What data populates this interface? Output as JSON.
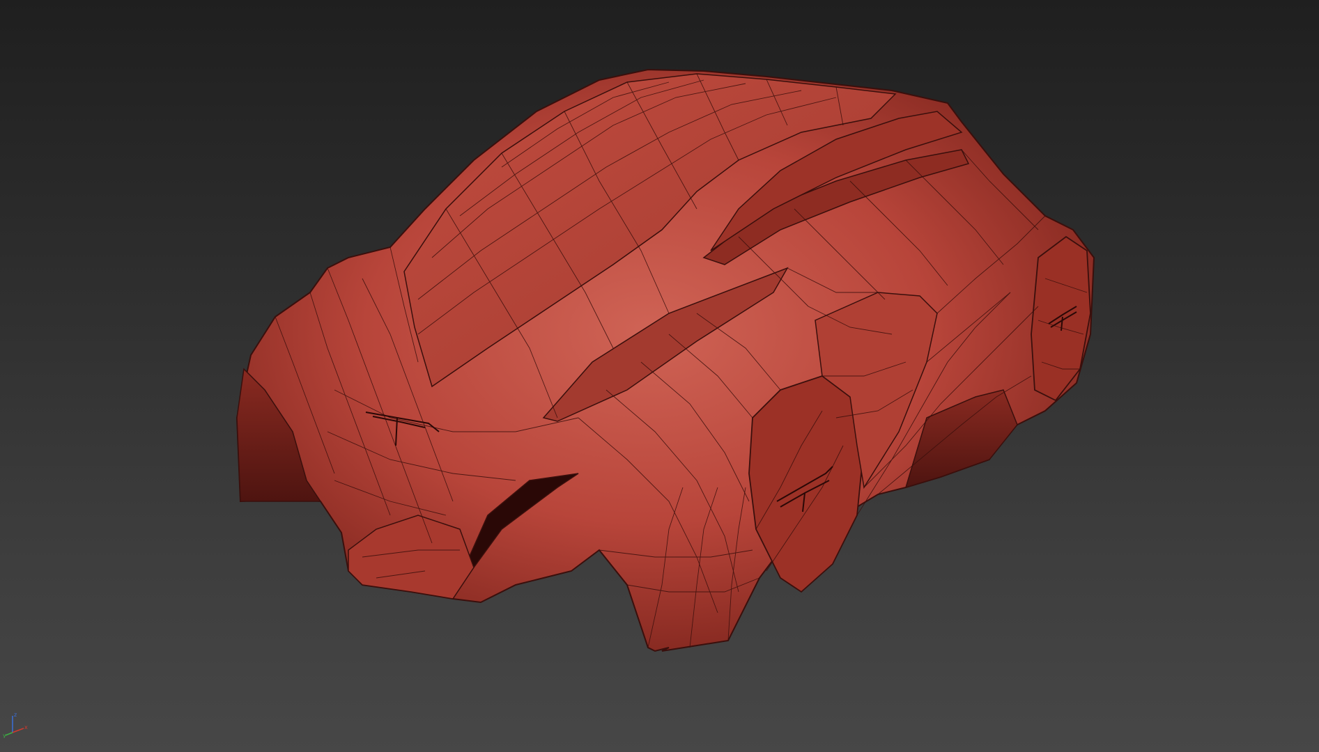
{
  "viewport": {
    "background_top": "#1f1f1f",
    "background_bottom": "#474747",
    "shading_mode": "edged-faces"
  },
  "model": {
    "description_icon": "car-body-mesh",
    "color_base": "#b8453a",
    "color_light": "#cf6355",
    "color_dark": "#6e1d17",
    "wire_color": "#3a0f0c"
  },
  "axis_gizmo": {
    "x_label": "x",
    "y_label": "y",
    "z_label": "z",
    "x_color": "#d03a2e",
    "y_color": "#3cb043",
    "z_color": "#3a6fd8"
  }
}
